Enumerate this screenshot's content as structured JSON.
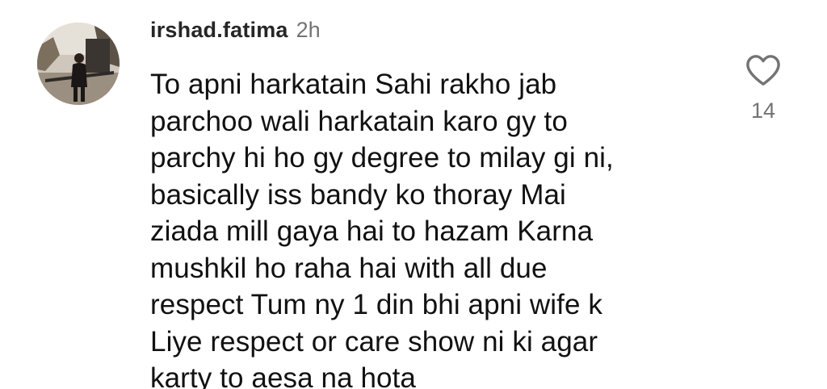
{
  "comment": {
    "username": "irshad.fatima",
    "time_ago": "2h",
    "text": "To apni harkatain Sahi rakho jab\nparchoo wali harkatain karo gy to\nparchy hi ho gy degree to milay gi ni,\nbasically iss bandy ko thoray Mai\nziada mill gaya hai to hazam Karna\nmushkil ho raha hai with all due\nrespect Tum ny 1 din bhi apni wife k\nLiye respect or care show ni ki agar\nkarty to aesa na hota",
    "like_count": "14",
    "like_icon": "heart-outline-icon"
  },
  "colors": {
    "text": "#111111",
    "username": "#262626",
    "secondary": "#737373"
  }
}
